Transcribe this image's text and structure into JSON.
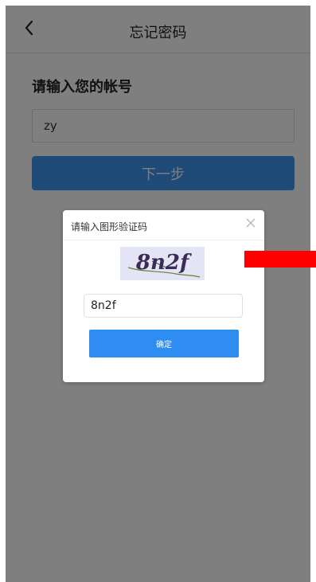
{
  "nav": {
    "back_icon": "chevron-left-icon",
    "title": "忘记密码"
  },
  "form": {
    "heading": "请输入您的帐号",
    "account_value": "zy",
    "next_label": "下一步"
  },
  "dialog": {
    "title": "请输入图形验证码",
    "close_icon": "close-icon",
    "captcha_text": "8n2f",
    "code_value": "8n2f",
    "confirm_label": "确定"
  },
  "colors": {
    "primary": "#2f8cf0",
    "overlay": "rgba(0,0,0,0.5)",
    "marker": "#ff0000"
  }
}
